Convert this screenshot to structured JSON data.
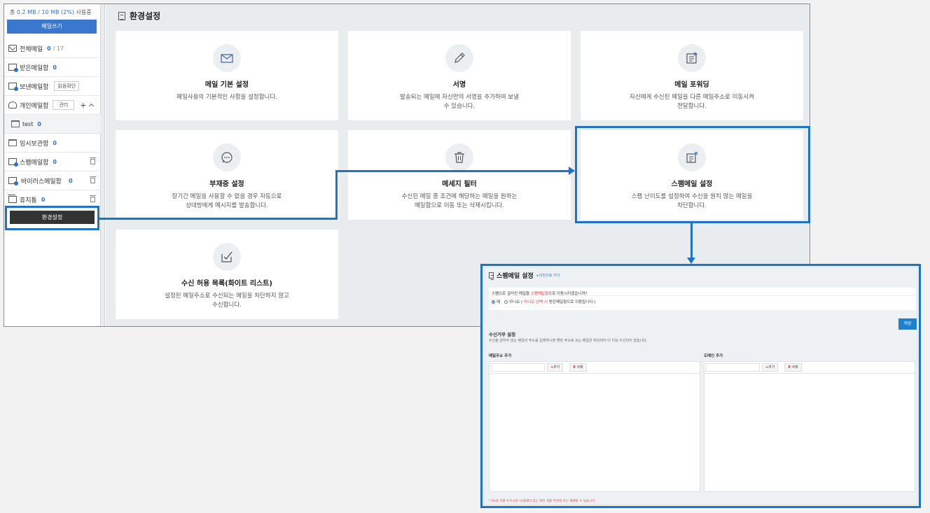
{
  "sidebar": {
    "usage_prefix": "총",
    "usage_value": "0.2 MB / 10 MB (2%)",
    "usage_suffix": "사용중",
    "compose_label": "메일쓰기",
    "items": [
      {
        "label": "전체메일",
        "count": "0",
        "total": "/ 17"
      },
      {
        "label": "받은메일함",
        "count": "0"
      },
      {
        "label": "보낸메일함",
        "badge": "읽음확인"
      },
      {
        "label": "개인메일함",
        "badge": "관리",
        "plus": "+"
      },
      {
        "label": "test",
        "count": "0"
      },
      {
        "label": "임시보관함",
        "count": "0"
      },
      {
        "label": "스팸메일함",
        "count": "0"
      },
      {
        "label": "바이러스메일함",
        "count": "0"
      },
      {
        "label": "휴지통",
        "count": "0"
      }
    ],
    "settings_label": "환경설정"
  },
  "main": {
    "title": "환경설정",
    "cards": [
      {
        "icon": "mail-icon",
        "title": "메일 기본 설정",
        "desc": "메일사용의 기본적인 사항을 설정합니다."
      },
      {
        "icon": "pen-icon",
        "title": "서명",
        "desc": "발송되는 메일에 자신만의 서명을 추가하여 보낼 수 있습니다."
      },
      {
        "icon": "forward-icon",
        "title": "메일 포워딩",
        "desc": "자신에게 수신된 메일을 다른 메일주소로 이동시켜 전달합니다."
      },
      {
        "icon": "chat-icon",
        "title": "부재중 설정",
        "desc": "장기간 메일을 사용할 수 없을 경우 자동으로 상대방에게 메시지를 발송합니다."
      },
      {
        "icon": "trash-icon",
        "title": "메세지 필터",
        "desc": "수신된 메일 중 조건에 해당하는 메일을 원하는 메일함으로 이동 또는 삭제시킵니다."
      },
      {
        "icon": "spam-icon",
        "title": "스팸메일 설정",
        "desc": "스팸 난이도를 설정하여 수신을 원치 않는 메일을 차단합니다."
      },
      {
        "icon": "check-icon",
        "title": "수신 허용 목록(화이트 리스트)",
        "desc": "설정된 메일주소로 수신되는 메일을 차단하지 않고 수신합니다."
      }
    ]
  },
  "spam_panel": {
    "title": "스팸메일 설정",
    "back_link": "◂ 이전으로 가기",
    "question_pre": "스팸으로 걸러진 메일을",
    "question_red": "스팸메일함",
    "question_post": "으로 이동시키겠습니까?",
    "opt_yes": "예",
    "opt_no_pre": "아니요 (",
    "opt_no_red": "아니오 선택 시",
    "opt_no_post": "받은메일함으로 이동됩니다.)",
    "save_label": "저장",
    "section_title": "수신거부 설정",
    "section_desc": "수신을 원하지 않는 메일의 주소를 입력하시면 해당 주소로 오는 메일은 차단되어 더 이상 수신되지 않습니다.",
    "col_email_title": "메일주소 추가",
    "col_domain_title": "도메인 추가",
    "add_label": "추가",
    "delete_label": "삭제",
    "footnote": "* Shift 키를 누르시면 시/클래이 있는 여러 개를 한번에 또는 해제할 수 있습니다."
  }
}
